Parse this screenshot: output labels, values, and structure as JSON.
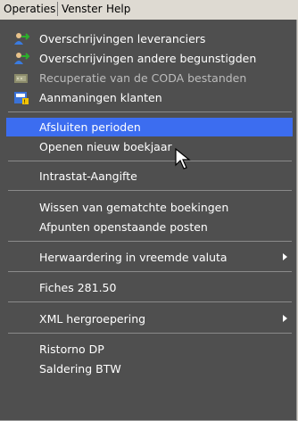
{
  "menubar": {
    "items": [
      {
        "label": "Operaties"
      },
      {
        "label": "Venster"
      },
      {
        "label": "Help"
      }
    ]
  },
  "menu": {
    "items": [
      {
        "label": "Overschrijvingen leveranciers",
        "icon": "people-transfer-icon"
      },
      {
        "label": "Overschrijvingen andere begunstigden",
        "icon": "people-transfer-icon"
      },
      {
        "label": "Recuperatie van de CODA bestanden",
        "icon": "coda-import-icon",
        "disabled": true
      },
      {
        "label": "Aanmaningen klanten",
        "icon": "reminder-icon"
      },
      {
        "label": "Afsluiten perioden",
        "highlighted": true
      },
      {
        "label": "Openen nieuw boekjaar"
      },
      {
        "label": "Intrastat-Aangifte"
      },
      {
        "label": "Wissen van gematchte boekingen"
      },
      {
        "label": "Afpunten openstaande posten"
      },
      {
        "label": "Herwaardering in vreemde valuta",
        "submenu": true
      },
      {
        "label": "Fiches 281.50"
      },
      {
        "label": "XML hergroepering",
        "submenu": true
      },
      {
        "label": "Ristorno DP"
      },
      {
        "label": "Saldering BTW"
      }
    ]
  },
  "colors": {
    "menu_bg": "#4f4f4f",
    "highlight": "#3c6df0",
    "menubar_bg": "#dedad2"
  }
}
